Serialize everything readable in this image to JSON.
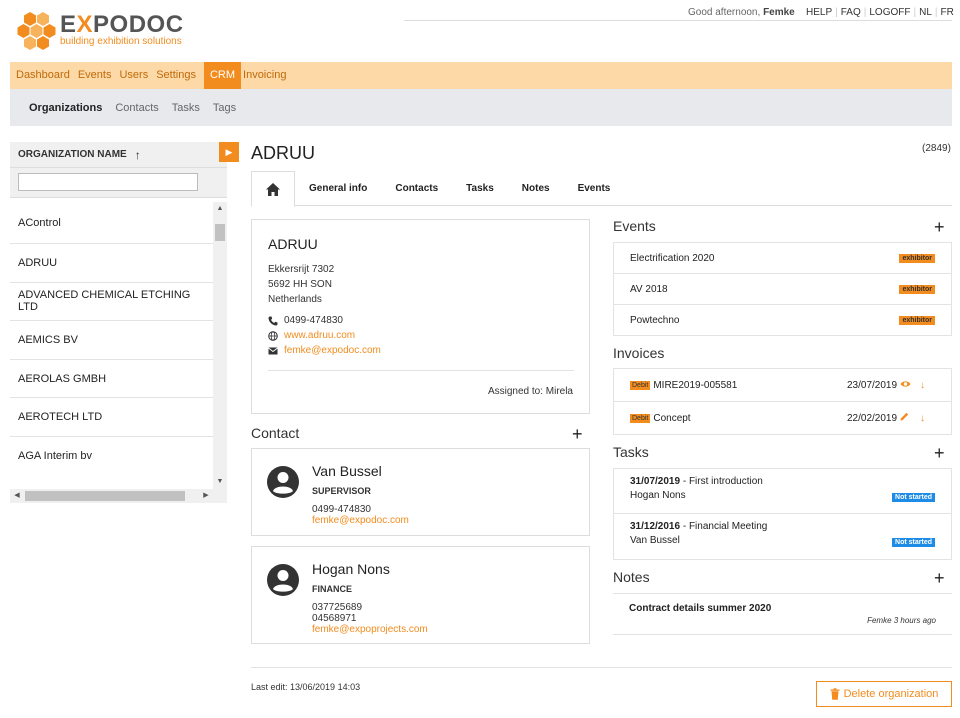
{
  "header": {
    "logo_main_pre": "E",
    "logo_main_x": "X",
    "logo_main_post": "PODOC",
    "logo_sub": "building exhibition solutions",
    "greeting_prefix": "Good afternoon,",
    "greeting_name": "Femke",
    "links": [
      "HELP",
      "FAQ",
      "LOGOFF",
      "NL",
      "FR"
    ]
  },
  "nav": {
    "items": [
      "Dashboard",
      "Events",
      "Users",
      "Settings",
      "CRM",
      "Invoicing"
    ],
    "active": "CRM"
  },
  "subnav": {
    "items": [
      "Organizations",
      "Contacts",
      "Tasks",
      "Tags"
    ],
    "active": "Organizations"
  },
  "left_panel": {
    "column_header": "ORGANIZATION NAME",
    "search_value": "",
    "organizations": [
      "AControl",
      "ADRUU",
      "ADVANCED CHEMICAL ETCHING LTD",
      "AEMICS BV",
      "AEROLAS GMBH",
      "AEROTECH LTD",
      "AGA Interim bv"
    ]
  },
  "org": {
    "title": "ADRUU",
    "count": "(2849)",
    "tabs": [
      "General info",
      "Contacts",
      "Tasks",
      "Notes",
      "Events"
    ],
    "card": {
      "name": "ADRUU",
      "address1": "Ekkersrijt 7302",
      "address2": "5692 HH SON",
      "country": "Netherlands",
      "phone": "0499-474830",
      "website": "www.adruu.com",
      "email": "femke@expodoc.com",
      "assigned": "Assigned to: Mirela"
    }
  },
  "contact": {
    "title": "Contact",
    "people": [
      {
        "name": "Van Bussel",
        "role": "SUPERVISOR",
        "phone1": "0499-474830",
        "phone2": "",
        "email": "femke@expodoc.com"
      },
      {
        "name": "Hogan Nons",
        "role": "FINANCE",
        "phone1": "037725689",
        "phone2": "04568971",
        "email": "femke@expoprojects.com"
      }
    ]
  },
  "events": {
    "title": "Events",
    "items": [
      {
        "name": "Electrification 2020",
        "badge": "exhibitor"
      },
      {
        "name": "AV 2018",
        "badge": "exhibitor"
      },
      {
        "name": "Powtechno",
        "badge": "exhibitor"
      }
    ]
  },
  "invoices": {
    "title": "Invoices",
    "items": [
      {
        "type": "Debit",
        "number": "MIRE2019-005581",
        "date": "23/07/2019"
      },
      {
        "type": "Debit",
        "number": "Concept",
        "date": "22/02/2019"
      }
    ]
  },
  "tasks": {
    "title": "Tasks",
    "items": [
      {
        "date": "31/07/2019",
        "title": " - First introduction",
        "person": "Hogan Nons",
        "status": "Not started"
      },
      {
        "date": "31/12/2016",
        "title": " - Financial Meeting",
        "person": "Van Bussel",
        "status": "Not started"
      }
    ]
  },
  "notes": {
    "title": "Notes",
    "items": [
      {
        "text": "Contract details summer 2020",
        "meta": "Femke 3 hours ago"
      }
    ]
  },
  "footer": {
    "last_edit": "Last edit: 13/06/2019 14:03",
    "delete_label": "Delete organization"
  },
  "colors": {
    "accent": "#f28c1e",
    "nav_bg": "#fcd9a6",
    "subnav_bg": "#e7e9ec",
    "status_blue": "#1e8be6"
  }
}
